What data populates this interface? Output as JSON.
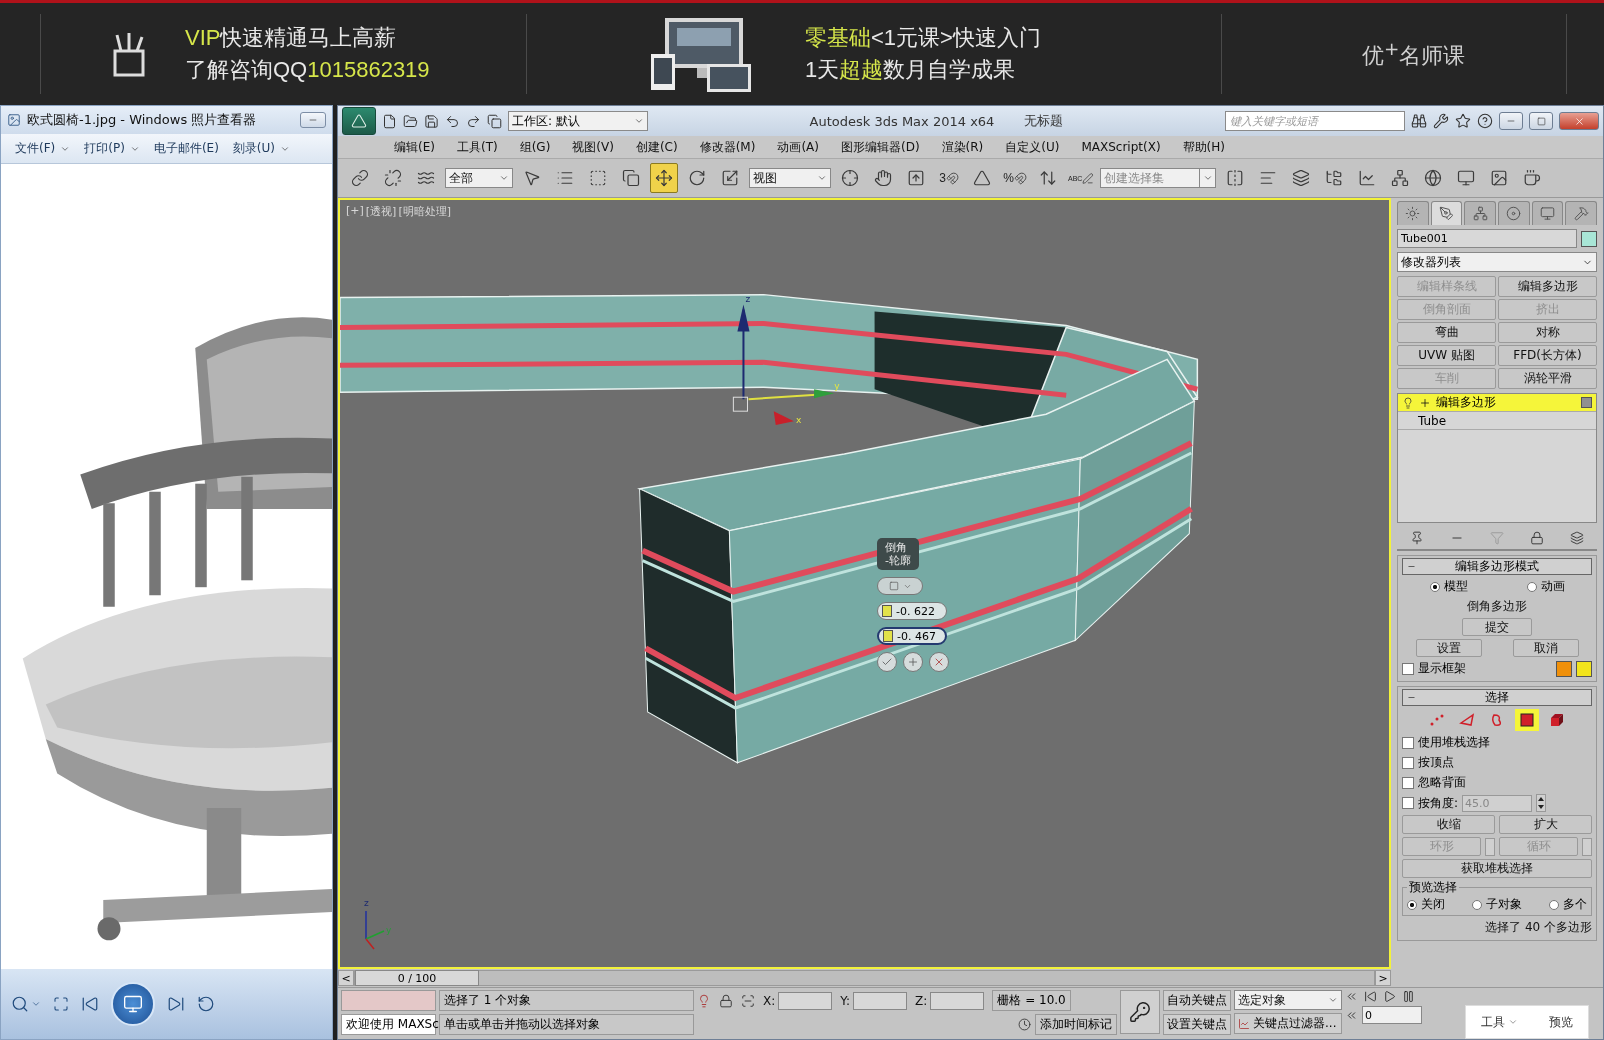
{
  "banner": {
    "left_lines": [
      [
        {
          "text": "VIP",
          "accent": true
        },
        {
          "text": "快速精通马上高薪",
          "accent": false
        }
      ],
      [
        {
          "text": "了解咨询QQ",
          "accent": false
        },
        {
          "text": "1015862319",
          "accent": true
        }
      ]
    ],
    "center_lines": [
      [
        {
          "text": "零基础",
          "accent": true
        },
        {
          "text": "<1元课>快速入门",
          "accent": false
        }
      ],
      [
        {
          "text": "1天",
          "accent": false
        },
        {
          "text": "超越",
          "accent": true
        },
        {
          "text": "数月自学成果",
          "accent": false
        }
      ]
    ],
    "brand": "优$^{+}$名师课"
  },
  "photo_viewer": {
    "title": "欧式圆椅-1.jpg - Windows 照片查看器",
    "menu": [
      {
        "label": "文件(F)",
        "has_menu": true
      },
      {
        "label": "打印(P)",
        "has_menu": true
      },
      {
        "label": "电子邮件(E)",
        "has_menu": false
      },
      {
        "label": "刻录(U)",
        "has_menu": true
      }
    ]
  },
  "max": {
    "workspace": "工作区: 默认",
    "title": "Autodesk 3ds Max  2014 x64",
    "document": "无标题",
    "search": {
      "placeholder": "键入关键字或短语"
    },
    "menu": [
      "编辑(E)",
      "工具(T)",
      "组(G)",
      "视图(V)",
      "创建(C)",
      "修改器(M)",
      "动画(A)",
      "图形编辑器(D)",
      "渲染(R)",
      "自定义(U)",
      "MAXScript(X)",
      "帮助(H)"
    ],
    "toolbar": [
      {
        "kind": "tool",
        "selected": false
      },
      {
        "kind": "tool",
        "selected": false
      },
      {
        "kind": "tool",
        "selected": false
      },
      {
        "kind": "dropdown",
        "value": "全部"
      },
      {
        "kind": "tool",
        "selected": false
      },
      {
        "kind": "tool",
        "selected": false
      },
      {
        "kind": "tool",
        "selected": false
      },
      {
        "kind": "tool",
        "selected": false
      },
      {
        "kind": "tool",
        "selected": true
      },
      {
        "kind": "tool",
        "selected": false
      },
      {
        "kind": "tool",
        "selected": false
      },
      {
        "kind": "dropdown",
        "value": "视图"
      },
      {
        "kind": "tool",
        "selected": false
      },
      {
        "kind": "tool",
        "selected": false
      },
      {
        "kind": "tool",
        "selected": false
      },
      {
        "kind": "tool",
        "selected": false,
        "glyph": "3"
      },
      {
        "kind": "tool",
        "selected": false
      },
      {
        "kind": "tool",
        "selected": false,
        "glyph": "%"
      },
      {
        "kind": "tool",
        "selected": false
      },
      {
        "kind": "tool",
        "selected": false,
        "glyph": "ABC"
      },
      {
        "kind": "named_set",
        "placeholder": "创建选择集"
      },
      {
        "kind": "tool",
        "selected": false
      },
      {
        "kind": "tool",
        "selected": false
      },
      {
        "kind": "tool",
        "selected": false
      },
      {
        "kind": "tool",
        "selected": false
      },
      {
        "kind": "tool",
        "selected": false
      },
      {
        "kind": "tool",
        "selected": false
      },
      {
        "kind": "tool",
        "selected": false
      },
      {
        "kind": "tool",
        "selected": false
      },
      {
        "kind": "tool",
        "selected": false
      },
      {
        "kind": "tool",
        "selected": false
      }
    ],
    "viewport": {
      "labels": [
        "[+]",
        "[透视]",
        "[明暗处理]"
      ],
      "active": true,
      "gizmo_labels": [
        "z",
        "y",
        "x"
      ],
      "tripod_labels": [
        "z",
        "y"
      ],
      "caddy": {
        "title": "倒角\n-轮廓",
        "fields": [
          {
            "value": "-0. 622",
            "selected": false
          },
          {
            "value": "-0. 467",
            "selected": true
          }
        ]
      }
    },
    "command_panel": {
      "tabs": [
        {
          "selected": false
        },
        {
          "selected": true
        },
        {
          "selected": false
        },
        {
          "selected": false
        },
        {
          "selected": false
        },
        {
          "selected": false
        }
      ],
      "object_name": "Tube001",
      "modifier_list": "修改器列表",
      "modifier_buttons": [
        {
          "label": "编辑样条线",
          "disabled": true
        },
        {
          "label": "编辑多边形",
          "disabled": false
        },
        {
          "label": "倒角剖面",
          "disabled": true
        },
        {
          "label": "挤出",
          "disabled": true
        },
        {
          "label": "弯曲",
          "disabled": false
        },
        {
          "label": "对称",
          "disabled": false
        },
        {
          "label": "UVW 贴图",
          "disabled": false
        },
        {
          "label": "FFD(长方体)",
          "disabled": false
        },
        {
          "label": "车削",
          "disabled": true
        },
        {
          "label": "涡轮平滑",
          "disabled": false
        }
      ],
      "stack": [
        {
          "label": "编辑多边形",
          "kind": "modifier",
          "selected": true
        },
        {
          "label": "Tube",
          "kind": "base",
          "selected": false
        }
      ],
      "edit_mode": {
        "title": "编辑多边形模式",
        "radios": [
          {
            "label": "模型",
            "selected": true
          },
          {
            "label": "动画",
            "selected": false
          }
        ],
        "operation": "倒角多边形",
        "commit": "提交",
        "buttons": [
          "设置",
          "取消"
        ],
        "show_cage": {
          "label": "显示框架",
          "checked": false
        }
      },
      "selection": {
        "title": "选择",
        "levels": [
          {
            "selected": false
          },
          {
            "selected": false
          },
          {
            "selected": false
          },
          {
            "selected": true
          },
          {
            "selected": false
          }
        ],
        "checkboxes": [
          {
            "label": "使用堆栈选择",
            "checked": false
          },
          {
            "label": "按顶点",
            "checked": false
          },
          {
            "label": "忽略背面",
            "checked": false
          }
        ],
        "by_angle": {
          "label": "按角度:",
          "checked": false,
          "value": "45.0"
        },
        "grow_shrink": [
          "收缩",
          "扩大"
        ],
        "ring_loop": [
          {
            "label": "环形",
            "disabled": true
          },
          {
            "label": "循环",
            "disabled": true
          }
        ],
        "get_stack": "获取堆栈选择",
        "preview": {
          "title": "预览选择",
          "options": [
            {
              "label": "关闭",
              "selected": true
            },
            {
              "label": "子对象",
              "selected": false
            },
            {
              "label": "多个",
              "selected": false
            }
          ]
        },
        "status": "选择了 40 个多边形"
      }
    },
    "timeline": {
      "prev": "<",
      "frame": "0 / 100",
      "next": ">"
    },
    "status": {
      "listener": "欢迎使用 MAXSc",
      "selection": "选择了 1 个对象",
      "prompt": "单击或单击并拖动以选择对象",
      "coords": [
        "X:",
        "Y:",
        "Z:"
      ],
      "grid": "栅格 = 10.0",
      "add_time_tag": "添加时间标记",
      "auto_key": "自动关键点",
      "set_key": "设置关键点",
      "key_mode": "选定对象",
      "key_filters": "关键点过滤器...",
      "frame": "0"
    }
  },
  "overlay": {
    "items": [
      {
        "label": "工具",
        "has_menu": true
      },
      {
        "label": "预览",
        "has_menu": false
      }
    ]
  }
}
